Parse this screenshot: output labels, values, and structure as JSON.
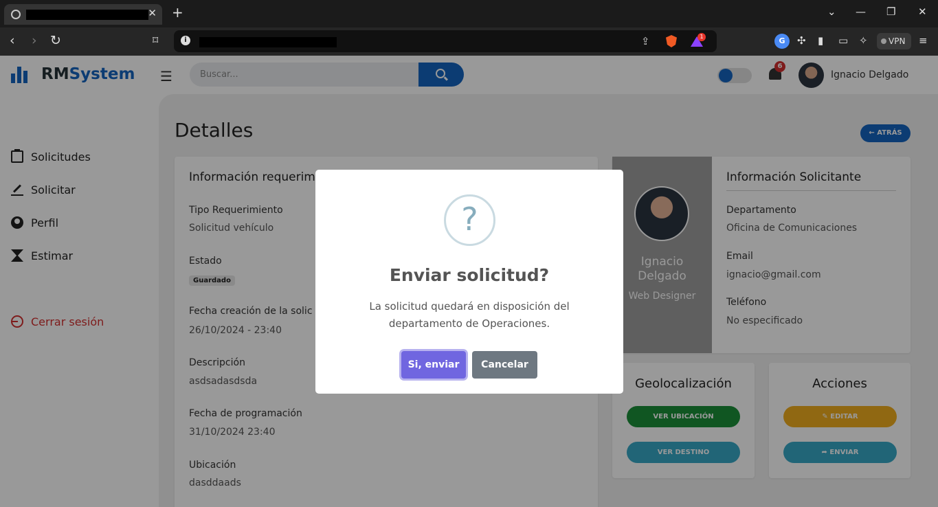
{
  "browser": {
    "vpn_label": "VPN",
    "notification_count_extension": "1"
  },
  "app": {
    "logo_prefix": "RM",
    "logo_suffix": "System",
    "search_placeholder": "Buscar...",
    "notifications_count": "6",
    "user_name": "Ignacio Delgado",
    "brand_color": "#1565c0"
  },
  "sidebar": {
    "items": [
      {
        "label": "Solicitudes",
        "icon": "clipboard-icon"
      },
      {
        "label": "Solicitar",
        "icon": "pen-icon"
      },
      {
        "label": "Perfil",
        "icon": "user-circle-icon"
      },
      {
        "label": "Estimar",
        "icon": "hourglass-icon"
      }
    ],
    "logout_label": "Cerrar sesión"
  },
  "page": {
    "title": "Detalles",
    "back_label": "← ATRÁS"
  },
  "info_card": {
    "title": "Información requerim",
    "fields": [
      {
        "label": "Tipo Requerimiento",
        "value": "Solicitud vehículo"
      },
      {
        "label": "Estado",
        "value": "Guardado"
      },
      {
        "label": "Fecha creación de la solic",
        "value": "26/10/2024 - 23:40"
      },
      {
        "label": "Descripción",
        "value": "asdsadasdsda"
      },
      {
        "label": "Fecha de programación",
        "value": "31/10/2024 23:40"
      },
      {
        "label": "Ubicación",
        "value": "dasddaads"
      }
    ]
  },
  "requester": {
    "name_line1": "Ignacio",
    "name_line2": "Delgado",
    "role": "Web Designer",
    "title": "Información Solicitante",
    "fields": [
      {
        "label": "Departamento",
        "value": "Oficina de Comunicaciones"
      },
      {
        "label": "Email",
        "value": "ignacio@gmail.com"
      },
      {
        "label": "Teléfono",
        "value": "No especificado"
      }
    ]
  },
  "geo_card": {
    "title": "Geolocalización",
    "view_location": "VER UBICACIÓN",
    "view_destination": "VER DESTINO"
  },
  "actions_card": {
    "title": "Acciones",
    "edit": "EDITAR",
    "send": "ENVIAR"
  },
  "modal": {
    "icon_glyph": "?",
    "title": "Enviar solicitud?",
    "text": "La solicitud quedará en disposición del departamento de Operaciones.",
    "confirm_label": "Si, enviar",
    "cancel_label": "Cancelar",
    "confirm_color": "#7066e0",
    "cancel_color": "#6e7881"
  }
}
